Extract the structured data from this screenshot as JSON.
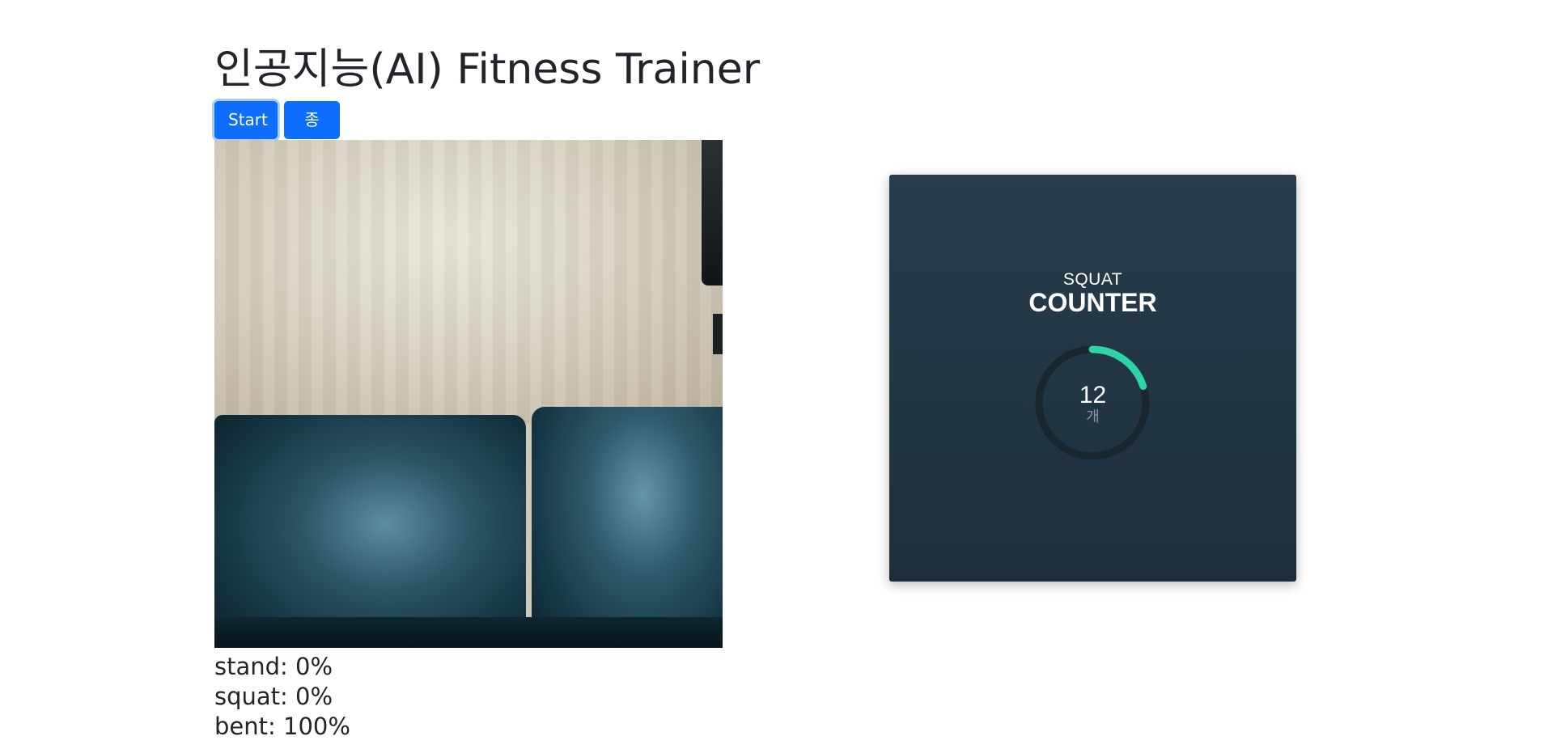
{
  "header": {
    "title": "인공지능(AI) Fitness Trainer"
  },
  "controls": {
    "start_label": "Start",
    "stop_label": "종료"
  },
  "predictions": [
    {
      "label": "stand",
      "value": "0%"
    },
    {
      "label": "squat",
      "value": "0%"
    },
    {
      "label": "bent",
      "value": "100%"
    }
  ],
  "counter": {
    "subtitle": "SQUAT",
    "title": "COUNTER",
    "count": "12",
    "unit": "개",
    "progress": 0.2,
    "colors": {
      "track": "#1a262e",
      "progress": "#2ed3a6",
      "background": "#22313d"
    }
  },
  "webcam": {
    "icon": "webcam-feed"
  }
}
